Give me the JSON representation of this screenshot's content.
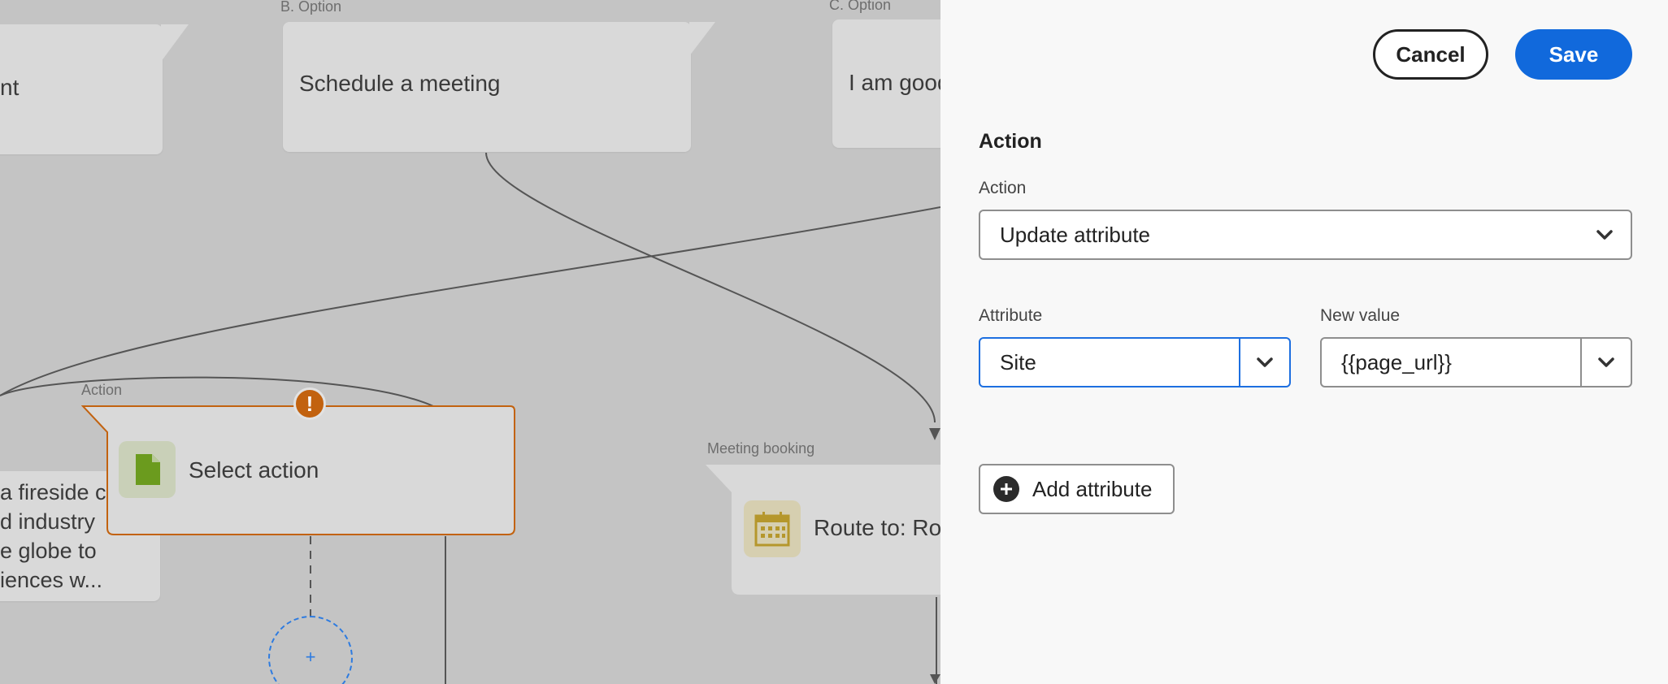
{
  "canvas": {
    "nodes": {
      "a_option": {
        "text": "nt"
      },
      "b_option": {
        "label": "B. Option",
        "text": "Schedule a meeting"
      },
      "c_option": {
        "label": "C. Option",
        "text": "I am good"
      },
      "action_node": {
        "label": "Action",
        "text": "Select action"
      },
      "left_card": {
        "lines": [
          "a fireside c",
          "d industry",
          "e globe to",
          "iences w..."
        ]
      },
      "meeting_node": {
        "label": "Meeting booking",
        "text": "Route to: Rou"
      }
    },
    "add_step_symbol": "+",
    "warning_symbol": "!",
    "colors": {
      "warning": "#c2620f",
      "document_icon": "#6b9b1e",
      "calendar_icon": "#b5972c",
      "dashed": "#2d7be0"
    }
  },
  "panel": {
    "cancel_label": "Cancel",
    "save_label": "Save",
    "section_title": "Action",
    "action_field": {
      "label": "Action",
      "value": "Update attribute"
    },
    "attribute_field": {
      "label": "Attribute",
      "value": "Site"
    },
    "new_value_field": {
      "label": "New value",
      "value": "{{page_url}}"
    },
    "add_attribute_label": "Add attribute",
    "colors": {
      "primary": "#1169dc",
      "focus": "#1d6fe0"
    }
  }
}
